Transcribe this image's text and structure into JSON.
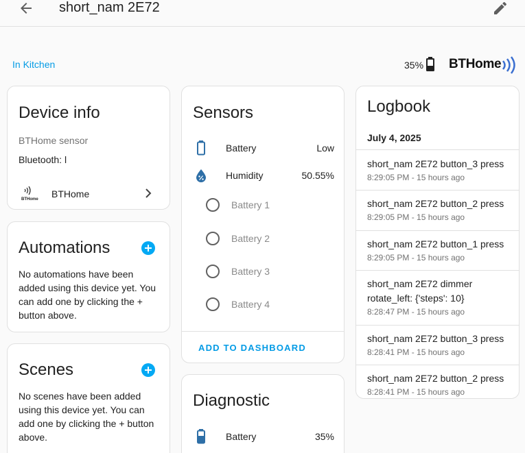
{
  "header": {
    "title": "short_nam 2E72",
    "back_icon": "arrow-left-icon",
    "edit_icon": "pencil-icon"
  },
  "device": {
    "area": "In Kitchen",
    "battery": "35%",
    "brand": "BTHome"
  },
  "device_info": {
    "title": "Device info",
    "model": "BTHome sensor",
    "connection": "Bluetooth: l",
    "integration": "BTHome"
  },
  "automations": {
    "title": "Automations",
    "empty_text": "No automations have been added using this device yet. You can add one by clicking the + button above."
  },
  "scenes": {
    "title": "Scenes",
    "empty_text": "No scenes have been added using this device yet. You can add one by clicking the + button above."
  },
  "sensors": {
    "title": "Sensors",
    "items": [
      {
        "label": "Battery",
        "value": "Low",
        "icon": "battery-outline-icon"
      },
      {
        "label": "Humidity",
        "value": "50.55%",
        "icon": "water-percent-icon"
      }
    ],
    "options": [
      "Battery 1",
      "Battery 2",
      "Battery 3",
      "Battery 4"
    ],
    "action": "ADD TO DASHBOARD"
  },
  "diagnostic": {
    "title": "Diagnostic",
    "items": [
      {
        "label": "Battery",
        "value": "35%",
        "icon": "battery-low-icon"
      }
    ]
  },
  "logbook": {
    "title": "Logbook",
    "date": "July 4, 2025",
    "entries": [
      {
        "message": "short_nam 2E72 button_3 press",
        "time": "8:29:05 PM - 15 hours ago"
      },
      {
        "message": "short_nam 2E72 button_2 press",
        "time": "8:29:05 PM - 15 hours ago"
      },
      {
        "message": "short_nam 2E72 button_1 press",
        "time": "8:29:05 PM - 15 hours ago"
      },
      {
        "message": "short_nam 2E72 dimmer rotate_left: {'steps': 10}",
        "time": "8:28:47 PM - 15 hours ago"
      },
      {
        "message": "short_nam 2E72 button_3 press",
        "time": "8:28:41 PM - 15 hours ago"
      },
      {
        "message": "short_nam 2E72 button_2 press",
        "time": "8:28:41 PM - 15 hours ago"
      }
    ]
  },
  "colors": {
    "accent": "#03a9f4",
    "link": "#039be5",
    "icon": "#2e6fa7"
  }
}
